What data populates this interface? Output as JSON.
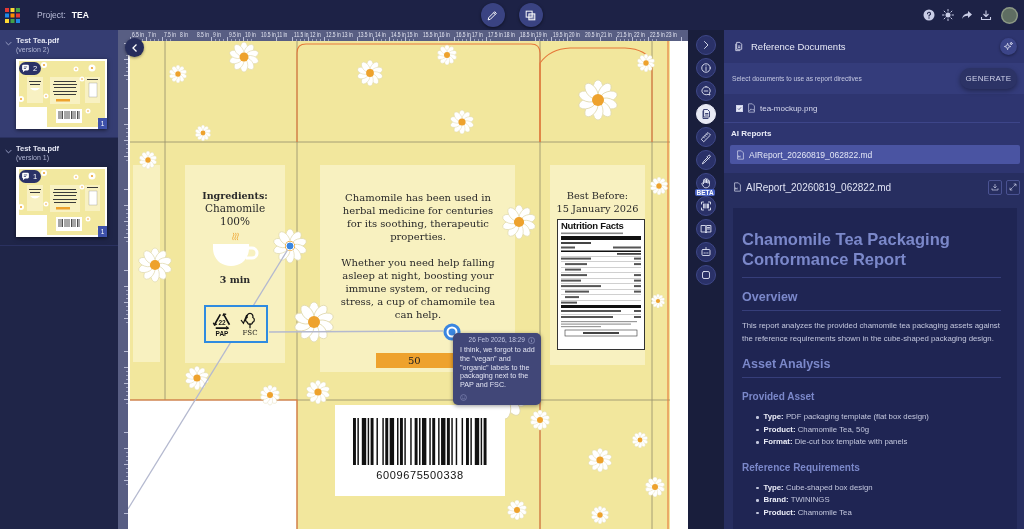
{
  "topbar": {
    "project_label": "Project:",
    "project_name": "TEA"
  },
  "versions": [
    {
      "file": "Test Tea.pdf",
      "version": "(version 2)",
      "comments": "2",
      "page": "1",
      "selected": true
    },
    {
      "file": "Test Tea.pdf",
      "version": "(version 1)",
      "comments": "1",
      "page": "1",
      "selected": false
    }
  ],
  "ruler": {
    "top": [
      "6.5 in",
      "7 in",
      "7.5 in",
      "8 in",
      "8.5 in",
      "9 in",
      "9.5 in",
      "10 in",
      "10.5 in",
      "11 in",
      "11.5 in",
      "12 in",
      "12.5 in",
      "13 in",
      "13.5 in",
      "14 in",
      "14.5 in",
      "15 in",
      "15.5 in",
      "16 in",
      "16.5 in",
      "17 in",
      "17.5 in",
      "18 in",
      "18.5 in",
      "19 in",
      "19.5 in",
      "20 in",
      "20.5 in",
      "21 in",
      "21.5 in",
      "22 in",
      "22.5 in",
      "23 in"
    ]
  },
  "artwork": {
    "ingredients": {
      "heading": "Ingredients:",
      "name": "Chamomile",
      "percent": "100%",
      "steep_time": "3 min"
    },
    "certifications": {
      "selected": true,
      "recycling_code": "22",
      "recycling_label": "PAP",
      "forest_label": "FSC"
    },
    "description": [
      "Chamomile has been used in herbal medicine for centuries for its soothing, therapeutic properties.",
      "Whether you need help falling asleep at night, boosting your immune system, or reducing stress, a cup of chamomile tea can help."
    ],
    "weight": "50",
    "best_before": {
      "label": "Best Before:",
      "date": "15 January 2026"
    },
    "nutrition": {
      "title": "Nutrition Facts"
    },
    "barcode": "6009675500338",
    "comment": {
      "date": "26 Feb 2026, 18:29",
      "text": "I think, we forgot to add the \"vegan\" and \"organic\" labels to the packaging next to the PAP and FSC."
    }
  },
  "rail": [
    {
      "kind": "expand",
      "selected": false
    },
    {
      "kind": "info",
      "selected": false
    },
    {
      "kind": "comments",
      "selected": false
    },
    {
      "kind": "documents",
      "selected": true
    },
    {
      "kind": "measure",
      "selected": false
    },
    {
      "kind": "picker",
      "selected": false
    },
    {
      "kind": "hand",
      "selected": false,
      "badge": "BETA"
    },
    {
      "kind": "scan",
      "selected": false
    },
    {
      "kind": "book",
      "selected": false
    },
    {
      "kind": "robot",
      "selected": false
    },
    {
      "kind": "frame",
      "selected": false
    }
  ],
  "reference_panel": {
    "title": "Reference Documents",
    "hint": "Select documents to use as report directives",
    "generate": "GENERATE",
    "documents": [
      {
        "name": "tea-mockup.png",
        "checked": true
      }
    ],
    "reports_heading": "AI Reports",
    "reports": [
      {
        "name": "AIReport_20260819_062822.md",
        "selected": true
      }
    ]
  },
  "report_viewer": {
    "file": "AIReport_20260819_062822.md",
    "blocks": [
      {
        "kind": "h1",
        "text": "Chamomile Tea Packaging Conformance Report"
      },
      {
        "kind": "h2",
        "text": "Overview"
      },
      {
        "kind": "p",
        "text": "This report analyzes the provided chamomile tea packaging assets against the reference requirements shown in the cube-shaped packaging design."
      },
      {
        "kind": "h2",
        "text": "Asset Analysis"
      },
      {
        "kind": "h3",
        "text": "Provided Asset"
      },
      {
        "kind": "list",
        "items": [
          "**Type:** PDF packaging template (flat box design)",
          "**Product:** Chamomile Tea, 50g",
          "**Format:** Die-cut box template with panels"
        ]
      },
      {
        "kind": "h3",
        "text": "Reference Requirements"
      },
      {
        "kind": "list",
        "items": [
          "**Type:** Cube-shaped box design",
          "**Brand:** TWININGS",
          "**Product:** Chamomile Tea"
        ]
      }
    ]
  }
}
